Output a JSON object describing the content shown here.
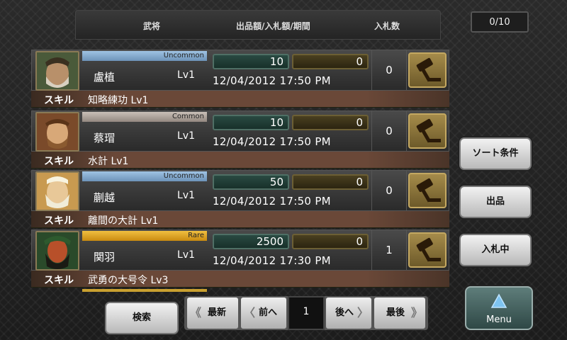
{
  "header": {
    "col_general": "武将",
    "col_price": "出品額/入札額/期間",
    "col_bids": "入札数",
    "counter": "0/10"
  },
  "listings": [
    {
      "rarity": "Uncommon",
      "name": "盧植",
      "level": "Lv1",
      "price": "10",
      "bid": "0",
      "datetime": "12/04/2012   17:50 PM",
      "bids": "0",
      "skill_label": "スキル",
      "skill": "知略練功 Lv1"
    },
    {
      "rarity": "Common",
      "name": "蔡瑁",
      "level": "Lv1",
      "price": "10",
      "bid": "0",
      "datetime": "12/04/2012   17:50 PM",
      "bids": "0",
      "skill_label": "スキル",
      "skill": "水計 Lv1"
    },
    {
      "rarity": "Uncommon",
      "name": "蒯越",
      "level": "Lv1",
      "price": "50",
      "bid": "0",
      "datetime": "12/04/2012   17:50 PM",
      "bids": "0",
      "skill_label": "スキル",
      "skill": "離間の大計 Lv1"
    },
    {
      "rarity": "Rare",
      "name": "関羽",
      "level": "Lv1",
      "price": "2500",
      "bid": "0",
      "datetime": "12/04/2012   17:30 PM",
      "bids": "1",
      "skill_label": "スキル",
      "skill": "武勇の大号令 Lv3"
    }
  ],
  "side": {
    "sort": "ソート条件",
    "listing": "出品",
    "bidding": "入札中",
    "menu": "Menu"
  },
  "bottom": {
    "search": "検索",
    "newest": "最新",
    "prev": "前へ",
    "page": "1",
    "next": "後へ",
    "last": "最後"
  },
  "colors": {
    "uncommon": "#9fc3e3",
    "common": "#c9c0b8",
    "rare": "#f0c040"
  }
}
